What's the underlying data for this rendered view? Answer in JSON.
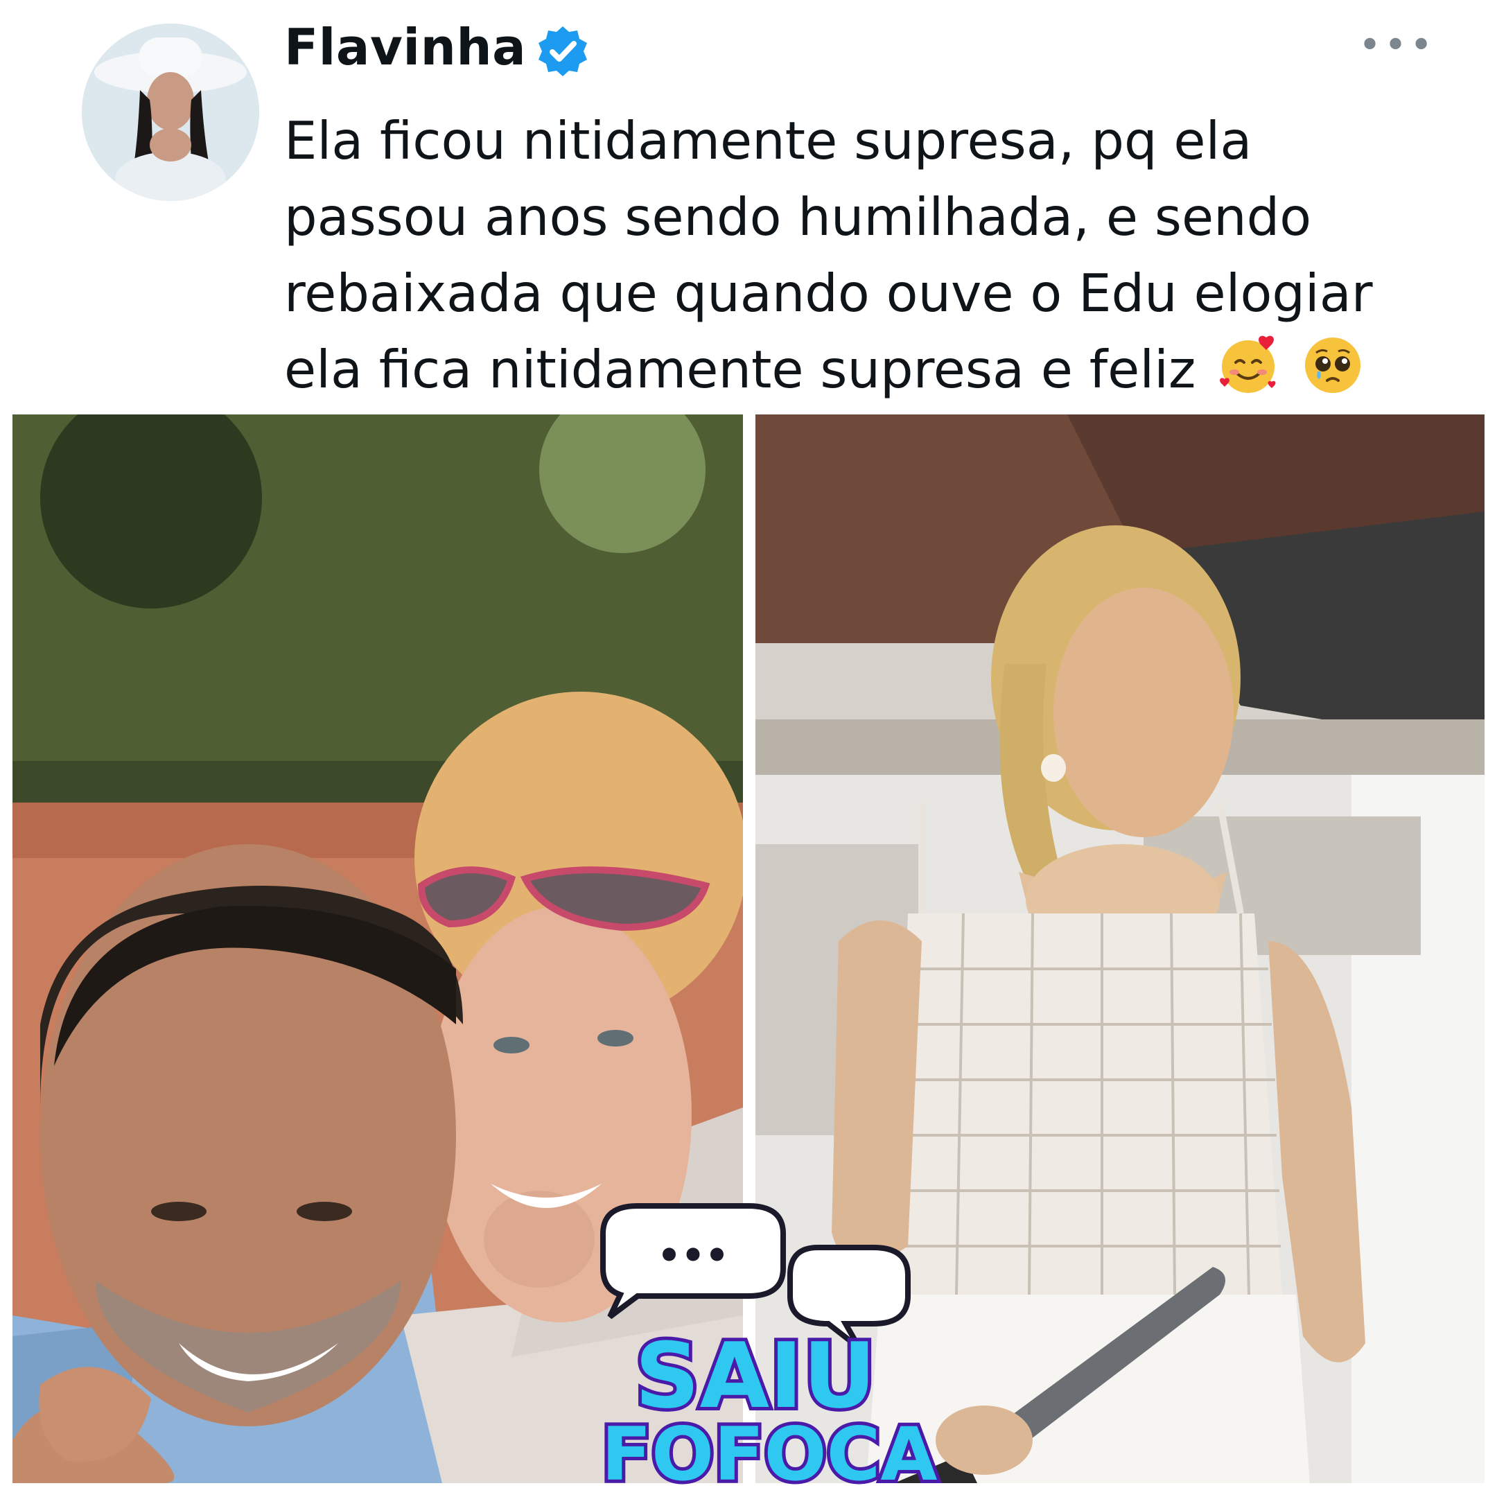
{
  "tweet": {
    "author": {
      "display_name": "Flavinha",
      "verified": true,
      "avatar_icon": "avatar-photo"
    },
    "more_icon": "more-horizontal-icon",
    "text_lines": [
      "Ela ficou nitidamente supresa, pq ela",
      "passou anos sendo humilhada, e sendo",
      "rebaixada que quando ouve o Edu elogiar",
      "ela fica nitidamente supresa e feliz"
    ],
    "emojis": [
      "smiling-face-with-hearts-emoji",
      "pleading-face-emoji"
    ],
    "colors": {
      "text": "#0f1419",
      "verified_badge": "#1d9bf0",
      "muted": "#7c868f"
    }
  },
  "media": [
    {
      "description_icon": "selfie-photo-icon"
    },
    {
      "description_icon": "kitchen-photo-icon"
    }
  ],
  "watermark": {
    "line1": "SAIU",
    "line2": "FOFOCA",
    "bubble_text": "•••",
    "colors": {
      "text_fill": "#2ec8f0",
      "outline": "#4a1aa8"
    }
  }
}
